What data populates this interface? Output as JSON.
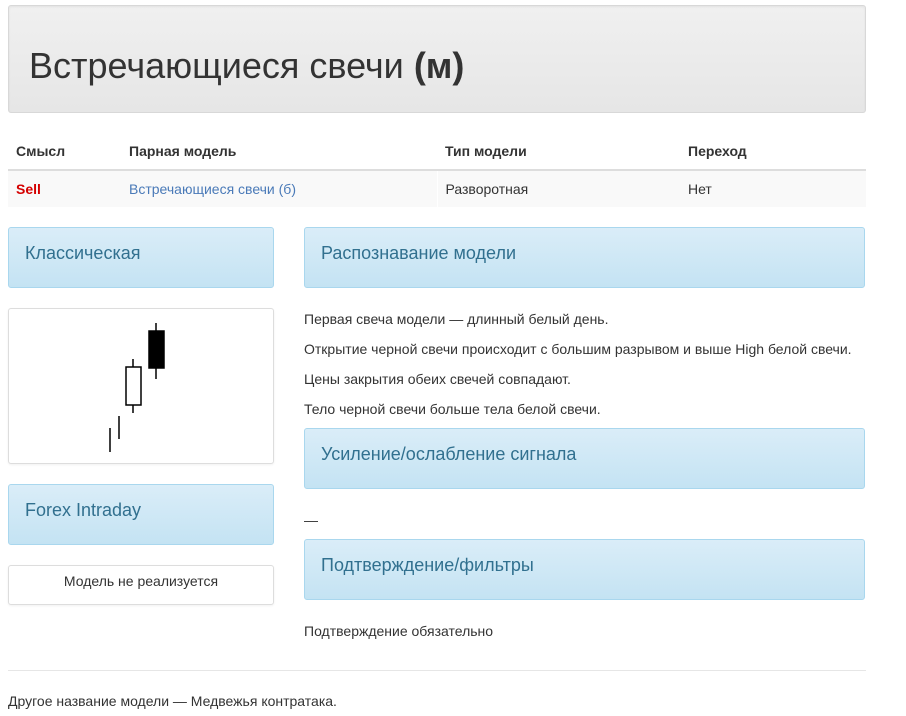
{
  "header": {
    "title_main": "Встречающиеся свечи",
    "title_suffix": "(м)"
  },
  "meta_table": {
    "headers": [
      "Смысл",
      "Парная модель",
      "Тип модели",
      "Переход"
    ],
    "row": {
      "signal": "Sell",
      "pair_model": "Встречающиеся свечи (б)",
      "model_type": "Разворотная",
      "transition": "Нет"
    },
    "colors": {
      "signal": "#d40000",
      "link": "#4a7ab8"
    }
  },
  "left": {
    "classic_title": "Классическая",
    "forex_title": "Forex Intraday",
    "forex_note": "Модель не реализуется",
    "chart_icon": "candlestick-pattern-icon"
  },
  "right": {
    "recognition_title": "Распознавание модели",
    "recognition_lines": [
      "Первая свеча модели — длинный белый день.",
      "Открытие черной свечи происходит с большим разрывом и выше High белой свечи.",
      "Цены закрытия обеих свечей совпадают.",
      "Тело черной свечи больше тела белой свечи."
    ],
    "signal_title": "Усиление/ослабление сигнала",
    "signal_text": "—",
    "confirm_title": "Подтверждение/фильтры",
    "confirm_text": "Подтверждение обязательно"
  },
  "footer": {
    "alt_name": "Другое название модели — Медвежья контратака."
  },
  "theme": {
    "panel_text": "#31708f",
    "panel_bg": "#c4e3f3",
    "panel_border": "#a9d7ee"
  }
}
